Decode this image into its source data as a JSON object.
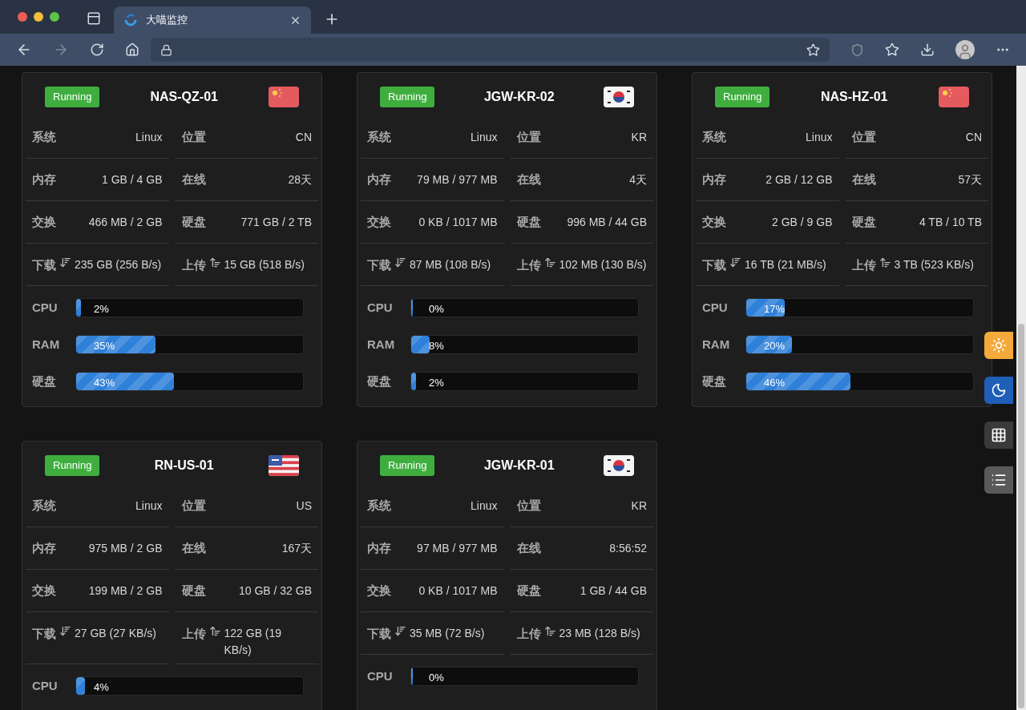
{
  "browser": {
    "tab_title": "大喵监控"
  },
  "cards": [
    {
      "status": "Running",
      "name": "NAS-QZ-01",
      "flag": {
        "kind": "cn"
      },
      "stats": [
        {
          "kind": "plain",
          "label": "系统",
          "value": "Linux"
        },
        {
          "kind": "plain",
          "label": "位置",
          "value": "CN"
        },
        {
          "kind": "plain",
          "label": "内存",
          "value": "1 GB / 4 GB"
        },
        {
          "kind": "plain",
          "label": "在线",
          "value": "28天"
        },
        {
          "kind": "plain",
          "label": "交换",
          "value": "466 MB / 2 GB"
        },
        {
          "kind": "plain",
          "label": "硬盘",
          "value": "771 GB / 2 TB"
        },
        {
          "kind": "download",
          "label": "下载",
          "value": "235 GB (256 B/s)"
        },
        {
          "kind": "upload",
          "label": "上传",
          "value": "15 GB (518 B/s)"
        }
      ],
      "bars": [
        {
          "label": "CPU",
          "level": 0.02,
          "reading": "2%"
        },
        {
          "label": "RAM",
          "level": 0.35,
          "reading": "35%"
        },
        {
          "label": "硬盘",
          "level": 0.43,
          "reading": "43%"
        }
      ]
    },
    {
      "status": "Running",
      "name": "JGW-KR-02",
      "flag": {
        "kind": "kr"
      },
      "stats": [
        {
          "kind": "plain",
          "label": "系统",
          "value": "Linux"
        },
        {
          "kind": "plain",
          "label": "位置",
          "value": "KR"
        },
        {
          "kind": "plain",
          "label": "内存",
          "value": "79 MB / 977 MB"
        },
        {
          "kind": "plain",
          "label": "在线",
          "value": "4天"
        },
        {
          "kind": "plain",
          "label": "交换",
          "value": "0 KB / 1017 MB"
        },
        {
          "kind": "plain",
          "label": "硬盘",
          "value": "996 MB / 44 GB"
        },
        {
          "kind": "download",
          "label": "下载",
          "value": "87 MB (108 B/s)"
        },
        {
          "kind": "upload",
          "label": "上传",
          "value": "102 MB (130 B/s)"
        }
      ],
      "bars": [
        {
          "label": "CPU",
          "level": 0,
          "reading": "0%"
        },
        {
          "label": "RAM",
          "level": 0.08,
          "reading": "8%"
        },
        {
          "label": "硬盘",
          "level": 0.02,
          "reading": "2%"
        }
      ]
    },
    {
      "status": "Running",
      "name": "NAS-HZ-01",
      "flag": {
        "kind": "cn"
      },
      "stats": [
        {
          "kind": "plain",
          "label": "系统",
          "value": "Linux"
        },
        {
          "kind": "plain",
          "label": "位置",
          "value": "CN"
        },
        {
          "kind": "plain",
          "label": "内存",
          "value": "2 GB / 12 GB"
        },
        {
          "kind": "plain",
          "label": "在线",
          "value": "57天"
        },
        {
          "kind": "plain",
          "label": "交换",
          "value": "2 GB / 9 GB"
        },
        {
          "kind": "plain",
          "label": "硬盘",
          "value": "4 TB / 10 TB"
        },
        {
          "kind": "download",
          "label": "下载",
          "value": "16 TB (21 MB/s)"
        },
        {
          "kind": "upload",
          "label": "上传",
          "value": "3 TB (523 KB/s)"
        }
      ],
      "bars": [
        {
          "label": "CPU",
          "level": 0.17,
          "reading": "17%"
        },
        {
          "label": "RAM",
          "level": 0.2,
          "reading": "20%"
        },
        {
          "label": "硬盘",
          "level": 0.46,
          "reading": "46%"
        }
      ]
    },
    {
      "status": "Running",
      "name": "RN-US-01",
      "flag": {
        "kind": "us"
      },
      "stats": [
        {
          "kind": "plain",
          "label": "系统",
          "value": "Linux"
        },
        {
          "kind": "plain",
          "label": "位置",
          "value": "US"
        },
        {
          "kind": "plain",
          "label": "内存",
          "value": "975 MB / 2 GB"
        },
        {
          "kind": "plain",
          "label": "在线",
          "value": "167天"
        },
        {
          "kind": "plain",
          "label": "交换",
          "value": "199 MB / 2 GB"
        },
        {
          "kind": "plain",
          "label": "硬盘",
          "value": "10 GB / 32 GB"
        },
        {
          "kind": "download",
          "label": "下载",
          "value": "27 GB (27 KB/s)"
        },
        {
          "kind": "upload",
          "label": "上传",
          "value": "122 GB (19 KB/s)"
        }
      ],
      "bars": [
        {
          "label": "CPU",
          "level": 0.04,
          "reading": "4%"
        }
      ]
    },
    {
      "status": "Running",
      "name": "JGW-KR-01",
      "flag": {
        "kind": "kr"
      },
      "stats": [
        {
          "kind": "plain",
          "label": "系统",
          "value": "Linux"
        },
        {
          "kind": "plain",
          "label": "位置",
          "value": "KR"
        },
        {
          "kind": "plain",
          "label": "内存",
          "value": "97 MB / 977 MB"
        },
        {
          "kind": "plain",
          "label": "在线",
          "value": "8:56:52"
        },
        {
          "kind": "plain",
          "label": "交换",
          "value": "0 KB / 1017 MB"
        },
        {
          "kind": "plain",
          "label": "硬盘",
          "value": "1 GB / 44 GB"
        },
        {
          "kind": "download",
          "label": "下载",
          "value": "35 MB (72 B/s)"
        },
        {
          "kind": "upload",
          "label": "上传",
          "value": "23 MB (128 B/s)"
        }
      ],
      "bars": [
        {
          "label": "CPU",
          "level": 0,
          "reading": "0%"
        }
      ]
    }
  ],
  "side_buttons": [
    {
      "kind": "sun"
    },
    {
      "kind": "moon"
    },
    {
      "kind": "grid"
    },
    {
      "kind": "list"
    }
  ]
}
